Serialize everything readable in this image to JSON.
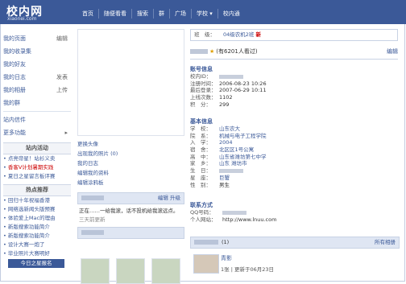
{
  "logo": {
    "text": "校内网",
    "sub": "xiaonei.com"
  },
  "nav": [
    "首页",
    "随便看看",
    "搜索",
    "群",
    "广场",
    "学校 ▾",
    "校内通"
  ],
  "sidebar": {
    "items": [
      {
        "label": "我的页面",
        "action": "编辑"
      },
      {
        "label": "我的收录集",
        "action": ""
      },
      {
        "label": "我的好友",
        "action": ""
      },
      {
        "label": "我的日志",
        "action": "发表"
      },
      {
        "label": "我的相册",
        "action": "上传"
      },
      {
        "label": "我的群",
        "action": ""
      },
      {
        "label": "站内信件",
        "action": ""
      },
      {
        "label": "更多功能",
        "action": "▸"
      }
    ],
    "activities_title": "站内活动",
    "activities": [
      "点亮帝星！站衫义卖",
      "香客V计划暑期实践",
      "夏日之星留言板评赛"
    ],
    "hot_title": "热点推荐",
    "hot": [
      "回归十年祝福香港",
      "网络选新闻头版预赛",
      "体验爱上Mac的理由",
      "新版搜索功能简介",
      "新版搜索功能简介",
      "设计大赛一炮了",
      "毕业照片大赛明好"
    ],
    "register_button": "今日之星报名"
  },
  "mid": {
    "links": [
      "更换头像",
      "出现我的照片 (0)",
      "我的日志",
      "编辑我的资料",
      "编辑涂鸦板"
    ],
    "status_header_actions": "编辑  升级",
    "status_text": "正在……一给我滚，话不投机给我滚远点。",
    "status_time": "三天前更新"
  },
  "main": {
    "school_label": "班　级：",
    "school_value": "04级农机2班",
    "school_new": "新",
    "visit_text": "(有6201人看过)",
    "edit": "编辑",
    "account_title": "账号信息",
    "account_rows": [
      {
        "k": "校内ID：",
        "v": ""
      },
      {
        "k": "注册时间：",
        "v": "2006-08-23 10:26"
      },
      {
        "k": "最后登录：",
        "v": "2007-06-29 10:11"
      },
      {
        "k": "上线次数：",
        "v": "1102"
      },
      {
        "k": "积　分：",
        "v": "299"
      }
    ],
    "basic_title": "基本信息",
    "basic_rows": [
      {
        "k": "学　校：",
        "v": "山东农大",
        "link": true
      },
      {
        "k": "院　系：",
        "v": "机械与电子工程学院",
        "link": true
      },
      {
        "k": "入　学：",
        "v": "2004",
        "link": true
      },
      {
        "k": "宿　舍：",
        "v": "北区区1号公寓",
        "link": true
      },
      {
        "k": "高　中：",
        "v": "山东省潍坊第七中学",
        "link": true
      },
      {
        "k": "家　乡：",
        "v": "山东 潍坊市",
        "link": true
      },
      {
        "k": "生　日：",
        "v": "",
        "link": false
      },
      {
        "k": "星　座：",
        "v": "巨蟹",
        "link": true
      },
      {
        "k": "性　别：",
        "v": "男生",
        "link": false
      }
    ],
    "contact_title": "联系方式",
    "contact_rows": [
      {
        "k": "QQ号码：",
        "v": ""
      },
      {
        "k": "个人网站：",
        "v": "http://www.lnuu.com"
      }
    ],
    "album_count": "(1)",
    "album_all": "所有相册",
    "album_name": "青影",
    "album_update": "1张 | 更新于06月23日"
  }
}
